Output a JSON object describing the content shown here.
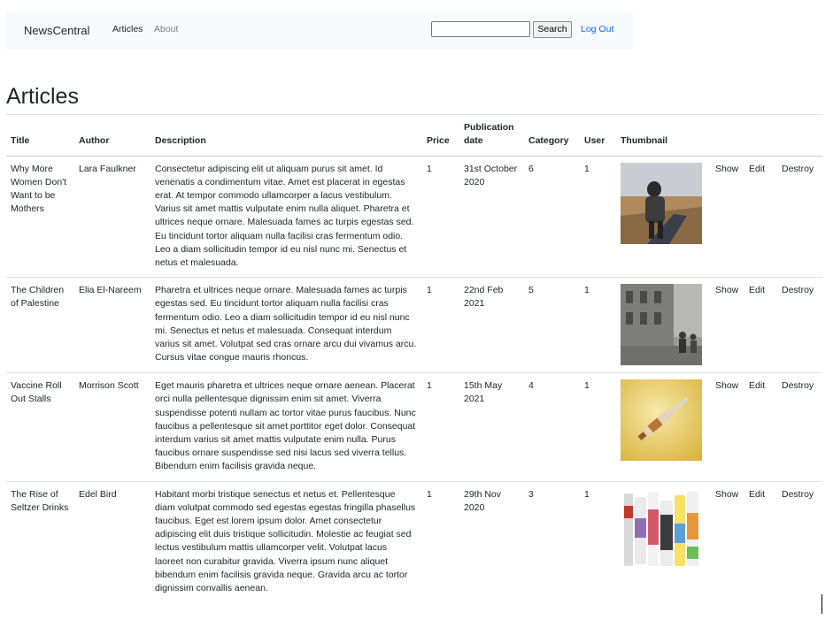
{
  "navbar": {
    "brand": "NewsCentral",
    "links": [
      {
        "label": "Articles"
      },
      {
        "label": "About"
      }
    ],
    "search": {
      "value": "",
      "placeholder": "",
      "button_label": "Search"
    },
    "logout_label": "Log Out"
  },
  "page": {
    "title": "Articles"
  },
  "table": {
    "headers": [
      "Title",
      "Author",
      "Description",
      "Price",
      "Publication date",
      "Category",
      "User",
      "Thumbnail",
      "",
      "",
      ""
    ],
    "rows": [
      {
        "title": "Why More Women Don't Want to be Mothers",
        "author": "Lara Faulkner",
        "description": "Consectetur adipiscing elit ut aliquam purus sit amet. Id venenatis a condimentum vitae. Amet est placerat in egestas erat. At tempor commodo ullamcorper a lacus vestibulum. Varius sit amet mattis vulputate enim nulla aliquet. Pharetra et ultrices neque ornare. Malesuada fames ac turpis egestas sed. Eu tincidunt tortor aliquam nulla facilisi cras fermentum odio. Leo a diam sollicitudin tempor id eu nisl nunc mi. Senectus et netus et malesuada.",
        "price": "1",
        "date": "31st October 2020",
        "category": "6",
        "user": "1",
        "thumbnail": "person-walking-photo",
        "actions": [
          "Show",
          "Edit",
          "Destroy"
        ]
      },
      {
        "title": "The Children of Palestine",
        "author": "Elia El-Nareem",
        "description": "Pharetra et ultrices neque ornare. Malesuada fames ac turpis egestas sed. Eu tincidunt tortor aliquam nulla facilisi cras fermentum odio. Leo a diam sollicitudin tempor id eu nisl nunc mi. Senectus et netus et malesuada. Consequat interdum varius sit amet. Volutpat sed cras ornare arcu dui vivamus arcu. Cursus vitae congue mauris rhoncus.",
        "price": "1",
        "date": "22nd Feb 2021",
        "category": "5",
        "user": "1",
        "thumbnail": "children-street-photo",
        "actions": [
          "Show",
          "Edit",
          "Destroy"
        ]
      },
      {
        "title": "Vaccine Roll Out Stalls",
        "author": "Morrison Scott",
        "description": "Eget mauris pharetra et ultrices neque ornare aenean. Placerat orci nulla pellentesque dignissim enim sit amet. Viverra suspendisse potenti nullam ac tortor vitae purus faucibus. Nunc faucibus a pellentesque sit amet porttitor eget dolor. Consequat interdum varius sit amet mattis vulputate enim nulla. Purus faucibus ornare suspendisse sed nisi lacus sed viverra tellus. Bibendum enim facilisis gravida neque.",
        "price": "1",
        "date": "15th May 2021",
        "category": "4",
        "user": "1",
        "thumbnail": "vaccine-syringe-photo",
        "actions": [
          "Show",
          "Edit",
          "Destroy"
        ]
      },
      {
        "title": "The Rise of Seltzer Drinks",
        "author": "Edel Bird",
        "description": "Habitant morbi tristique senectus et netus et. Pellentesque diam volutpat commodo sed egestas egestas fringilla phasellus faucibus. Eget est lorem ipsum dolor. Amet consectetur adipiscing elit duis tristique sollicitudin. Molestie ac feugiat sed lectus vestibulum mattis ullamcorper velit. Volutpat lacus laoreet non curabitur gravida. Viverra ipsum nunc aliquet bibendum enim facilisis gravida neque. Gravida arcu ac tortor dignissim convallis aenean.",
        "price": "1",
        "date": "29th Nov 2020",
        "category": "3",
        "user": "1",
        "thumbnail": "seltzer-cans-photo",
        "actions": [
          "Show",
          "Edit",
          "Destroy"
        ]
      }
    ]
  },
  "colors": {
    "link": "#0d6efd",
    "navbar_bg": "#f8f9fa",
    "text": "#212529"
  }
}
